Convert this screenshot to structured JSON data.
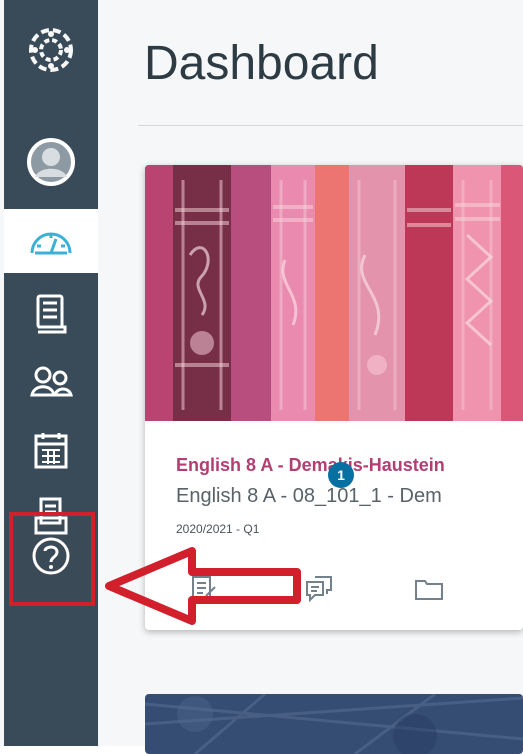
{
  "dashboard": {
    "title": "Dashboard"
  },
  "nav": {
    "items": [
      {
        "name": "canvas-logo-icon"
      },
      {
        "name": "account-avatar-icon"
      },
      {
        "name": "dashboard-icon"
      },
      {
        "name": "courses-icon"
      },
      {
        "name": "groups-icon"
      },
      {
        "name": "calendar-icon"
      },
      {
        "name": "inbox-icon"
      },
      {
        "name": "help-icon"
      }
    ],
    "active": "dashboard-icon",
    "help_highlight_color": "#d11f2b"
  },
  "course_card": {
    "title": "English 8 A - Demakis-Haustein",
    "subtitle": "English 8 A - 08_101_1 - Dem",
    "term": "2020/2021 - Q1",
    "badge_count": "1",
    "accent_color": "#b23f73",
    "actions": [
      "assignments-icon",
      "discussions-icon",
      "files-icon"
    ]
  },
  "colors": {
    "nav_background": "#394b58",
    "page_background": "#f6f7f8",
    "badge": "#0770a3",
    "annotation_red": "#d11f2b"
  }
}
